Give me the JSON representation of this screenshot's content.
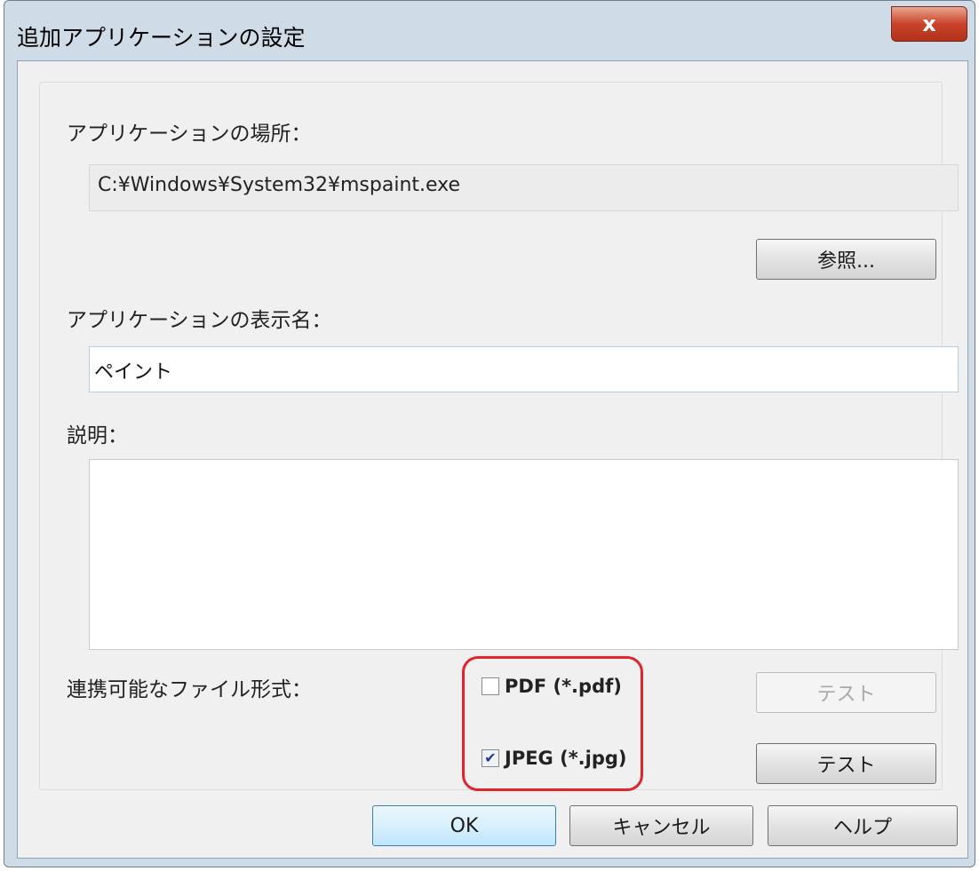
{
  "window": {
    "title": "追加アプリケーションの設定",
    "close_glyph": "x"
  },
  "form": {
    "location_label": "アプリケーションの場所：",
    "location_value": "C:¥Windows¥System32¥mspaint.exe",
    "browse_label": "参照...",
    "display_name_label": "アプリケーションの表示名：",
    "display_name_value": "ペイント",
    "description_label": "説明：",
    "description_value": "",
    "file_formats_label": "連携可能なファイル形式：",
    "formats": [
      {
        "label": "PDF (*.pdf)",
        "checked": false,
        "test_label": "テスト",
        "test_enabled": false
      },
      {
        "label": "JPEG (*.jpg)",
        "checked": true,
        "test_label": "テスト",
        "test_enabled": true
      }
    ]
  },
  "footer": {
    "ok_label": "OK",
    "cancel_label": "キャンセル",
    "help_label": "ヘルプ"
  },
  "colors": {
    "highlight": "#e0252e",
    "close_button": "#c9432a",
    "default_button_border": "#3c7fb1"
  },
  "icons": {
    "checkmark": "check-icon"
  }
}
